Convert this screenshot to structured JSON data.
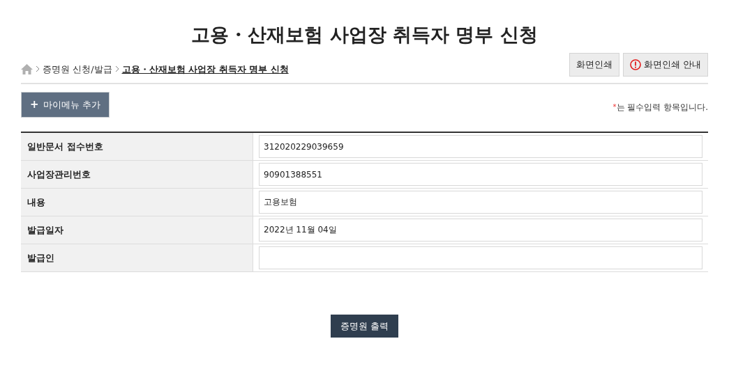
{
  "title": "고용・산재보험 사업장 취득자 명부 신청",
  "breadcrumb": [
    "증명원 신청/발급",
    "고용・산재보험 사업장 취득자 명부 신청"
  ],
  "top_buttons": [
    {
      "label": "화면인쇄",
      "kind": "plain"
    },
    {
      "label": "화면인쇄 안내",
      "kind": "info"
    }
  ],
  "add_menu_button": {
    "icon": "+",
    "label": "마이메뉴 추가"
  },
  "required_note": {
    "mark": "*",
    "text": "는 필수입력 항목입니다."
  },
  "form_rows": [
    {
      "label": "일반문서 접수번호",
      "value": "312020229039659"
    },
    {
      "label": "사업장관리번호",
      "value": "90901388551"
    },
    {
      "label": "내용",
      "value": "고용보험"
    },
    {
      "label": "발급일자",
      "value": "2022년 11월 04일"
    },
    {
      "label": "발급인"
    }
  ],
  "print_button": "증명원 출력"
}
